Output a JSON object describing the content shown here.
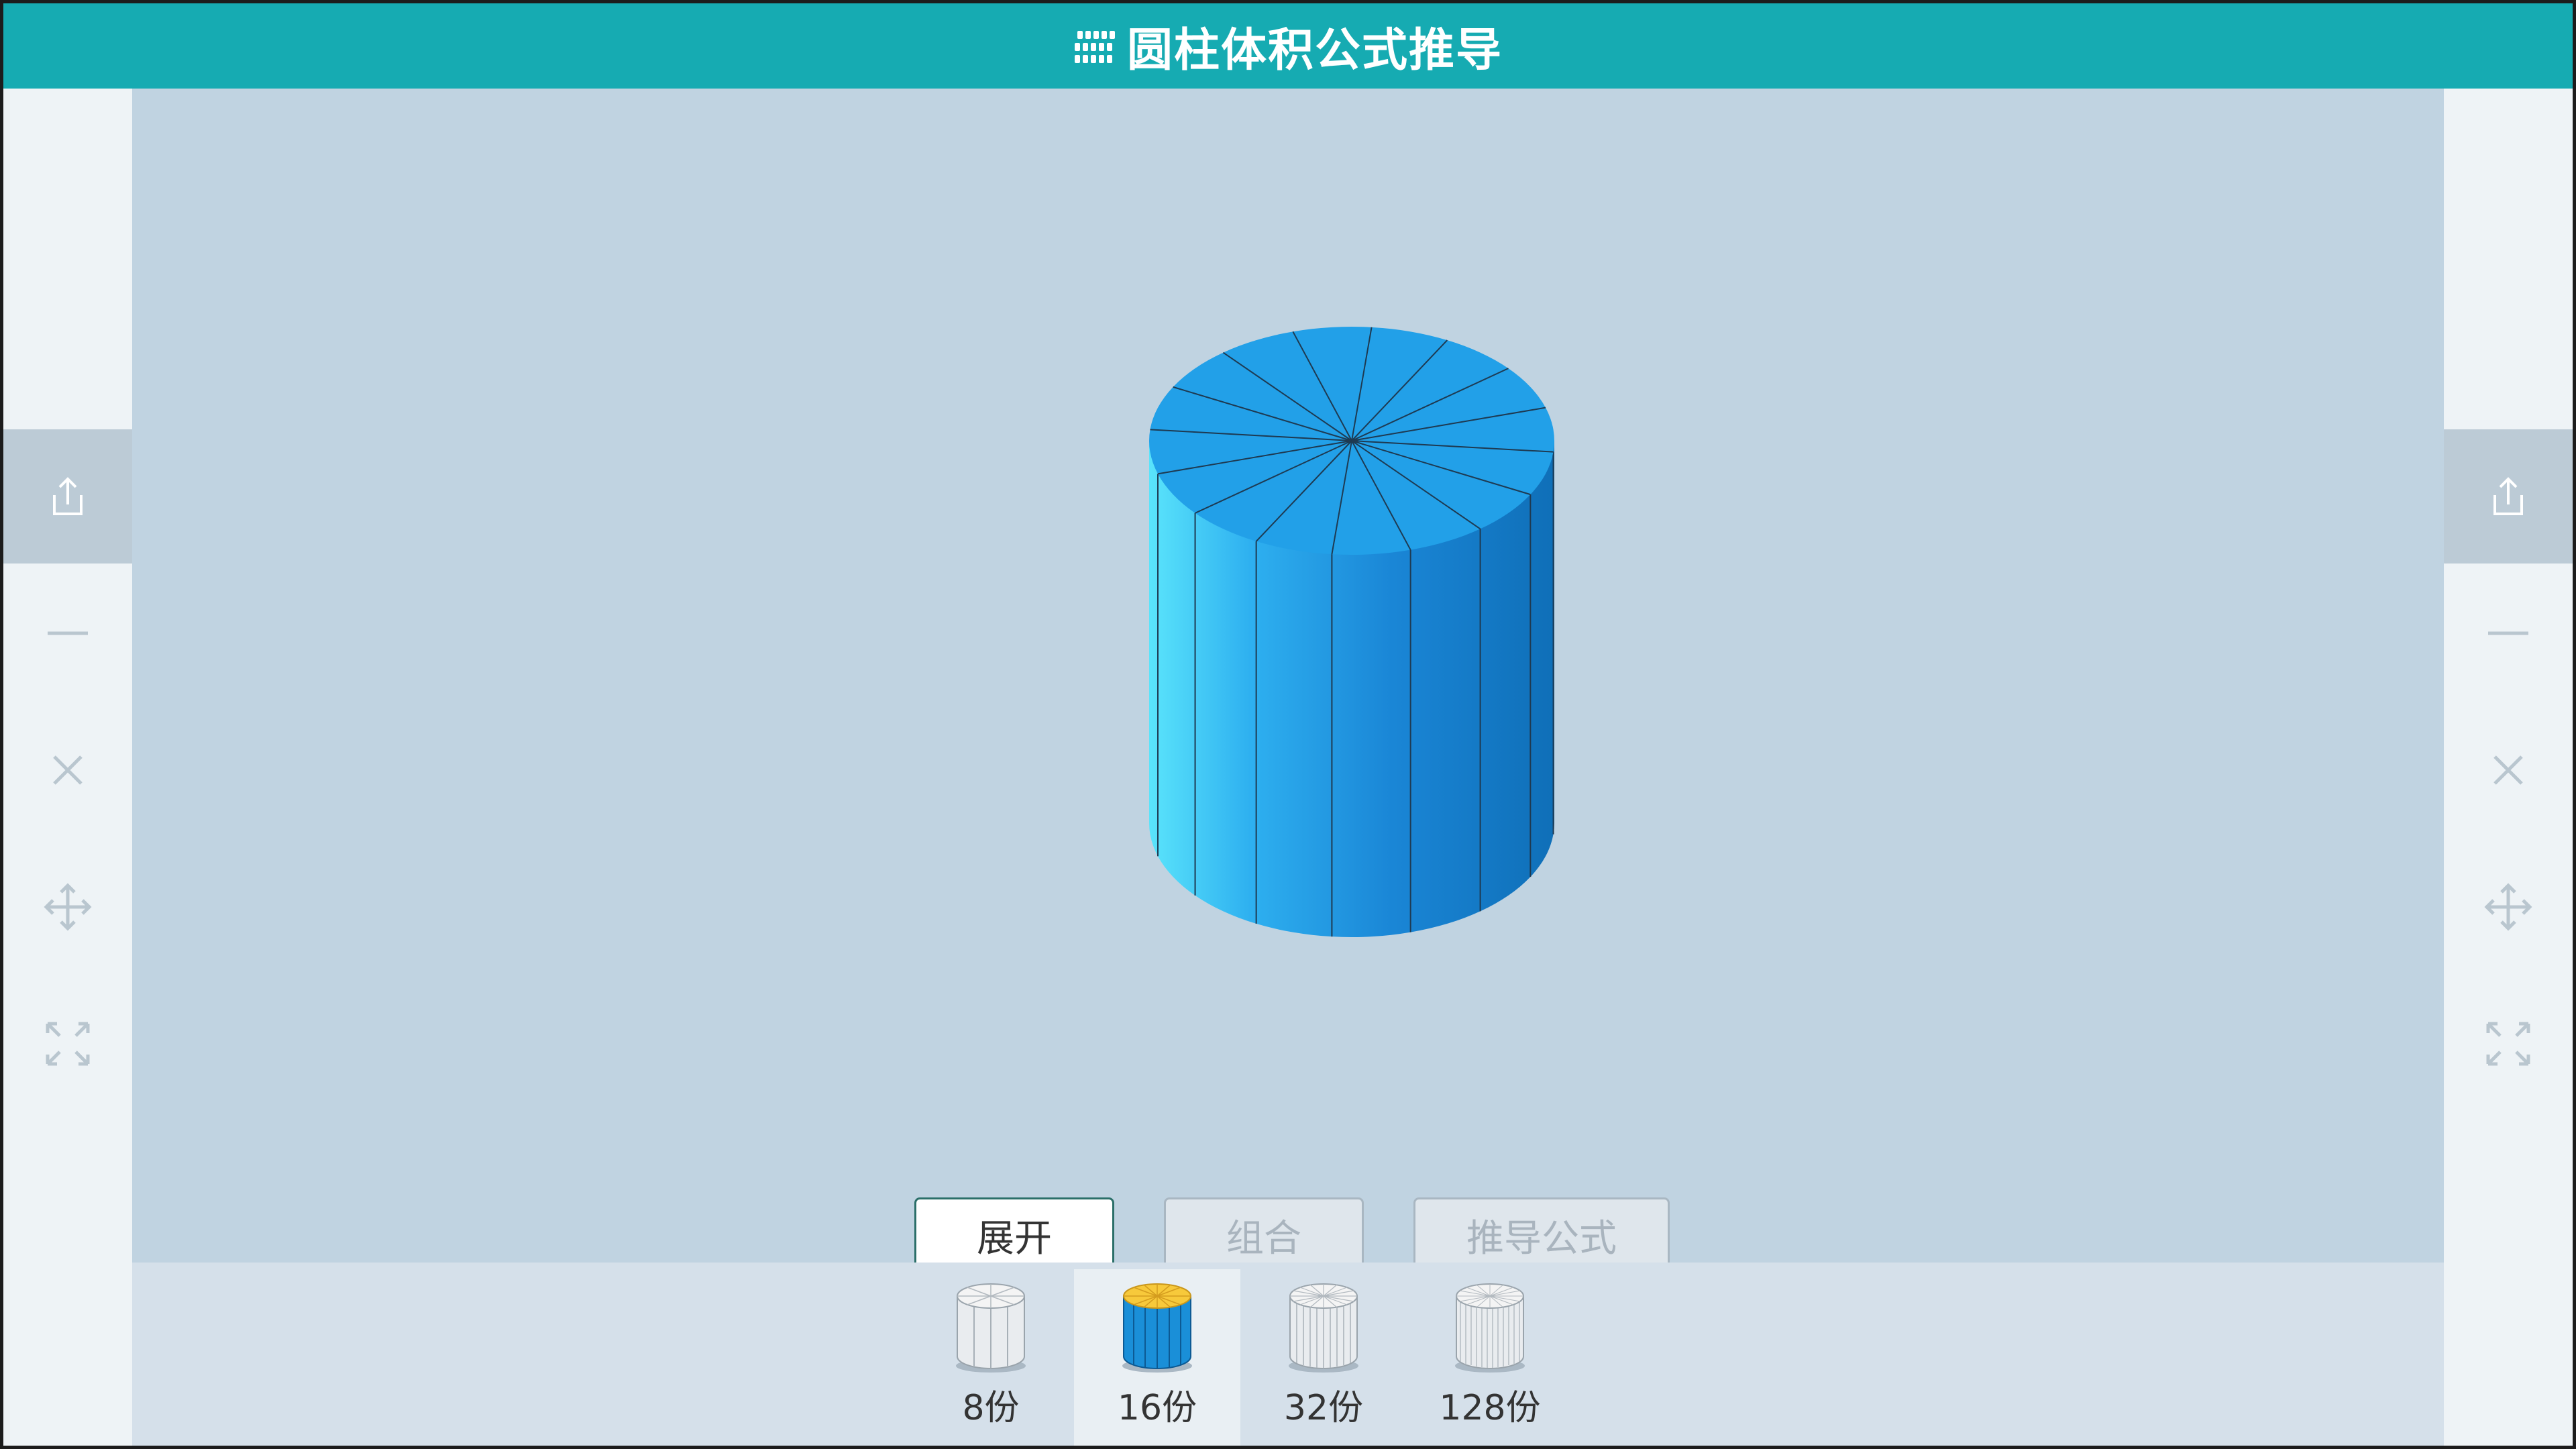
{
  "app": {
    "title": "圆柱体积公式推导",
    "logo_icon": "grid-logo-icon"
  },
  "sidebar": {
    "tools": [
      {
        "name": "share",
        "icon": "share-icon"
      },
      {
        "name": "minimize",
        "icon": "minus-icon"
      },
      {
        "name": "close",
        "icon": "close-icon"
      },
      {
        "name": "move",
        "icon": "move-icon"
      },
      {
        "name": "fullscreen",
        "icon": "expand-icon"
      }
    ]
  },
  "stage": {
    "model": "cylinder",
    "segments": 16,
    "colors": {
      "top": "#22a0e8",
      "side_light": "#4fd4f5",
      "side_dark": "#0f6fb8",
      "edge": "#1e3a52",
      "background": "#c0d3e1"
    }
  },
  "actions": {
    "expand_label": "展开",
    "combine_label": "组合",
    "derive_label": "推导公式"
  },
  "segment_options": [
    {
      "label": "8份",
      "selected": false
    },
    {
      "label": "16份",
      "selected": true
    },
    {
      "label": "32份",
      "selected": false
    },
    {
      "label": "128份",
      "selected": false
    }
  ],
  "colors": {
    "titlebar": "#16abb2",
    "primary_border": "#2b6f69"
  }
}
